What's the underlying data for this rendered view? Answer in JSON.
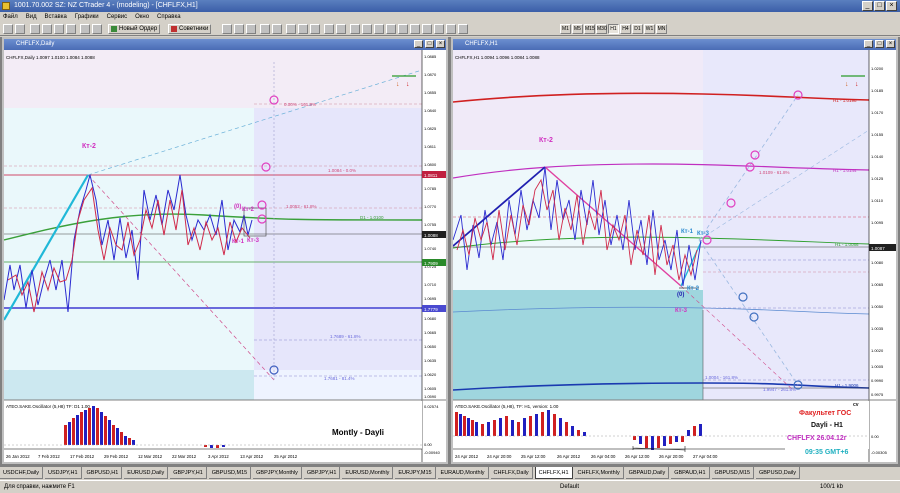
{
  "window": {
    "title": "1001.70.002 SZ: NZ CTrader 4 - (modeling) - [CHFLFX,H1]",
    "min": "_",
    "max": "□",
    "close": "×"
  },
  "menu": [
    "Файл",
    "Вид",
    "Вставка",
    "Графики",
    "Сервис",
    "Окно",
    "Справка"
  ],
  "toolbar": {
    "new_order": "Новый Ордер",
    "advisors": "Советники",
    "timeframes": [
      "M1",
      "M5",
      "M15",
      "M30",
      "H1",
      "H4",
      "D1",
      "W1",
      "MN"
    ],
    "active_timeframe": "H1"
  },
  "left_chart": {
    "window_title": "CHFLFX,Daily",
    "header": "CHFLFX,Daily  1.0097 1.0100 1.0084 1.0088",
    "labels": {
      "kt2": "Кт-2",
      "kt0": "(0)",
      "kt1": "Кт-1",
      "kt3": "Кт-3",
      "kt2b": "Кт-2"
    },
    "levels": [
      "0.00% - 161.8%",
      "1.0084 - 0.0%",
      "1.0052 - 61.8%",
      "D1 - 1.0100",
      "1.7689 - 61.8%",
      "1.7681 - 81.4%"
    ],
    "price_axis": [
      "1.0885",
      "1.0870",
      "1.0855",
      "1.0840",
      "1.0825",
      "1.0811",
      "1.0800",
      "1.0785",
      "1.0770",
      "1.0755",
      "1.0740",
      "1.0725",
      "1.0710",
      "1.0695",
      "1.0680",
      "1.0665",
      "1.0650",
      "1.0635",
      "1.0620",
      "1.0605",
      "1.0590"
    ],
    "price_tags": [
      "1.0811",
      "1.0088",
      "1.7909",
      "1.7779"
    ],
    "osc_title": "ATEO.SAKE.Oscillator (5,H8) TF: D1 1.00",
    "osc_axis": [
      "0.02574",
      "0.00",
      "-0.00940"
    ],
    "time_axis": [
      "26 Jan 2012",
      "7 Feb 2012",
      "17 Feb 2012",
      "29 Feb 2012",
      "12 Mar 2012",
      "22 Mar 2012",
      "3 Apr 2012",
      "13 Apr 2012",
      "25 Apr 2012"
    ],
    "caption": "Montly - Dayli"
  },
  "right_chart": {
    "window_title": "CHFLFX,H1",
    "header": "CHFLFX,H1  1.0094 1.0096 1.0084 1.0088",
    "labels": {
      "kt2": "Кт-2",
      "kt1": "Кт-1",
      "kt3": "Кт-3",
      "kt0": "(0)",
      "kt2b": "Кт-2",
      "kt3b": "Кт-3"
    },
    "levels": [
      "H1 - 1.0198",
      "H1 - 1.0144",
      "1.0109 - 61.8%",
      "H1 - 1.0086",
      "1.0004 - 161.8%",
      "1.9947 - 261.8%",
      "H1 - 1.9006"
    ],
    "price_axis": [
      "1.0200",
      "1.0185",
      "1.0170",
      "1.0155",
      "1.0140",
      "1.0125",
      "1.0110",
      "1.0095",
      "1.0080",
      "1.0065",
      "1.0050",
      "1.0035",
      "1.0020",
      "1.0005",
      "0.9990",
      "0.9975"
    ],
    "price_tag": "1.0087",
    "osc_title": "ATEO.SAKE.Oscillator (5,H8), TF: H1, version: 1.00",
    "osc_axis": [
      "0.00",
      "-0.00305"
    ],
    "time_axis": [
      "24 Apr 2012",
      "24 Apr 20:00",
      "25 Apr 12:00",
      "26 Apr 2012",
      "26 Apr 04:00",
      "26 Apr 12:00",
      "26 Apr 20:00",
      "27 Apr 04:00"
    ],
    "overlay": {
      "cv": "cv",
      "line1": "Факультет ГОС",
      "line2": "Dayli - H1",
      "line3": "CHFLFX 26.04.12г",
      "line4": "09:35 GMT+6"
    }
  },
  "symbol_tabs": [
    "USDCHF,Daily",
    "USDJPY,H1",
    "GBPUSD,H1",
    "EURUSD,Daily",
    "GBPJPY,H1",
    "GBPUSD,M15",
    "GBPJPY,Monthly",
    "GBPJPY,H1",
    "EURUSD,Monthly",
    "EURJPY,M15",
    "EURAUD,Monthly",
    "CHFLFX,Daily",
    "CHFLFX,H1",
    "CHFLFX,Monthly",
    "GBPAUD,Daily",
    "GBPAUD,H1",
    "GBPUSD,M15",
    "GBPUSD,Daily"
  ],
  "active_symbol_tab": "CHFLFX,H1",
  "status": {
    "help": "Для справки, нажмите F1",
    "profile": "Default",
    "traffic": "100/1 kb"
  }
}
